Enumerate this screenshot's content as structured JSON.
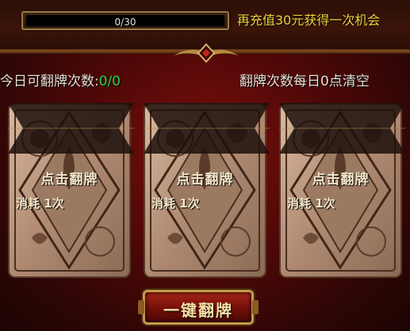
{
  "progress": {
    "text": "0/30",
    "value": 0,
    "max": 30
  },
  "recharge_text": "再充值30元获得一次机会",
  "today_label": "今日可翻牌次数:",
  "today_count": "0/0",
  "reset_text": "翻牌次数每日0点清空",
  "cards": [
    {
      "title": "点击翻牌",
      "cost_label": "消耗",
      "cost_value": "1次"
    },
    {
      "title": "点击翻牌",
      "cost_label": "消耗",
      "cost_value": "1次"
    },
    {
      "title": "点击翻牌",
      "cost_label": "消耗",
      "cost_value": "1次"
    }
  ],
  "flip_all_label": "一键翻牌",
  "colors": {
    "accent_yellow": "#f1d23a",
    "count_green": "#2fd24a",
    "panel_red": "#4c0807",
    "gold": "#c9a24a"
  }
}
